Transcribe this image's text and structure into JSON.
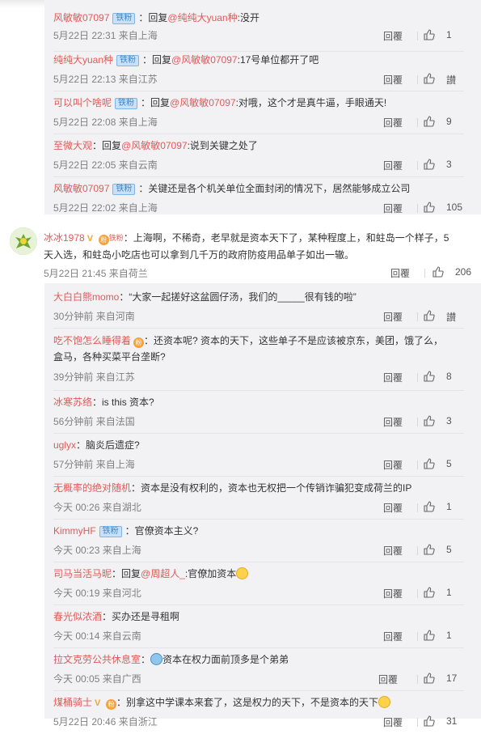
{
  "replies_top": [
    {
      "user": "风敏敏07097",
      "badge": "铁粉",
      "prefix": "：回复",
      "mention": "@纯纯大yuan种",
      "content": ":没开",
      "time": "5月22日 22:31",
      "loc": "来自上海",
      "reply_label": "回覆",
      "likes": "1"
    },
    {
      "user": "纯纯大yuan种",
      "badge": "铁粉",
      "prefix": "：回复",
      "mention": "@风敏敏07097",
      "content": ":17号单位都开了吧",
      "time": "5月22日 22:13",
      "loc": "来自江苏",
      "reply_label": "回覆",
      "likes": "讃"
    },
    {
      "user": "可以叫个啥呢",
      "badge": "铁粉",
      "prefix": "：回复",
      "mention": "@风敏敏07097",
      "content": ":对哦，这个才是真牛逼，手眼通天!",
      "time": "5月22日 22:08",
      "loc": "来自上海",
      "reply_label": "回覆",
      "likes": "9"
    },
    {
      "user": "至微大观",
      "badge": "",
      "prefix": "：回复",
      "mention": "@风敏敏07097",
      "content": ":说到关键之处了",
      "time": "5月22日 22:05",
      "loc": "来自云南",
      "reply_label": "回覆",
      "likes": "3"
    },
    {
      "user": "风敏敏07097",
      "badge": "铁粉",
      "prefix": "：",
      "mention": "",
      "content": "关键还是各个机关单位全面封闭的情况下，居然能够成立公司",
      "time": "5月22日 22:02",
      "loc": "来自上海",
      "reply_label": "回覆",
      "likes": "105"
    }
  ],
  "main_comment": {
    "user": "冰冰1978",
    "fan_badge": "铁粉",
    "line1": "：上海啊，不稀奇，老早就是资本天下了，某种程度上，和蛀岛一个样子，5",
    "line2": "天入选，和蛀岛小吃店也可以拿到几千万的政府防疫用品单子如出一辙。",
    "time": "5月22日 21:45",
    "loc": "来自荷兰",
    "reply_label": "回覆",
    "likes": "206"
  },
  "replies_bottom": [
    {
      "user": "大白白熊momo",
      "line1": "：“大家一起搓好这盆圆仔汤，我们的_____很有钱的啦”",
      "line2": "",
      "time": "30分钟前",
      "loc": "来自河南",
      "reply_label": "回覆",
      "likes": "讃"
    },
    {
      "user": "吃不饱怎么睡得着",
      "line1": "：还资本呢? 资本的天下，这些单子不是应该被京东，美团，饿了么，",
      "line2": "盒马，各种买菜平台垄断?",
      "time": "39分钟前",
      "loc": "来自江苏",
      "reply_label": "回覆",
      "likes": "8"
    },
    {
      "user": "冰寒苏络",
      "line1": "：is this 资本?",
      "line2": "",
      "time": "56分钟前",
      "loc": "来自法国",
      "reply_label": "回覆",
      "likes": "3"
    },
    {
      "user": "uglyx",
      "line1": "：脑炎后遗症?",
      "line2": "",
      "time": "57分钟前",
      "loc": "来自上海",
      "reply_label": "回覆",
      "likes": "5"
    },
    {
      "user": "无概率的绝对随机",
      "line1": "：资本是没有权利的，资本也无权把一个传销诈骗犯变成荷兰的IP",
      "line2": "",
      "time": "今天 00:26",
      "loc": "来自湖北",
      "reply_label": "回覆",
      "likes": "1"
    },
    {
      "user": "KimmyHF",
      "line1": "：官僚资本主义?",
      "line2": "",
      "time": "今天 00:23",
      "loc": "来自上海",
      "reply_label": "回覆",
      "likes": "5"
    },
    {
      "user": "司马当活马昵",
      "line1": "：回复",
      "mention": "@周超人_",
      "line1b": ":官僚加资本",
      "line2": "",
      "time": "今天 00:19",
      "loc": "来自河北",
      "reply_label": "回覆",
      "likes": "1"
    },
    {
      "user": "春光似浓酒",
      "line1": "：买办还是寻租啊",
      "line2": "",
      "time": "今天 00:14",
      "loc": "来自云南",
      "reply_label": "回覆",
      "likes": "1"
    },
    {
      "user": "拉文克劳公共休息室",
      "line1": "：",
      "line1b": "资本在权力面前顶多是个弟弟",
      "line2": "",
      "time": "今天 00:05",
      "loc": "来自广西",
      "reply_label": "回覆",
      "likes": "17"
    },
    {
      "user": "煤桶骑士",
      "line1": "：别拿这中学课本来套了，这是权力的天下，不是资本的天下",
      "line2": "",
      "time": "5月22日 20:46",
      "loc": "来自浙江",
      "reply_label": "回覆",
      "likes": "31"
    }
  ],
  "badges": {
    "tiefen": "铁粉"
  },
  "colors": {
    "username": "#e05a57",
    "meta": "#808080",
    "badge_bg": "#c8e1f8",
    "subbox_bg": "#f2f2f5"
  }
}
